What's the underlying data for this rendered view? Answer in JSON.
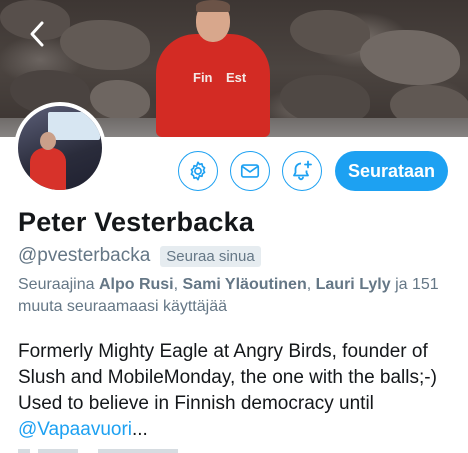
{
  "header": {
    "hoodie_text_left": "Fin",
    "hoodie_text_right": "Est"
  },
  "actions": {
    "settings_icon": "gear-icon",
    "message_icon": "envelope-icon",
    "notify_icon": "bell-plus-icon",
    "follow_label": "Seurataan"
  },
  "profile": {
    "name": "Peter Vesterbacka",
    "handle": "@pvesterbacka",
    "follows_you": "Seuraa sinua"
  },
  "followed_by": {
    "prefix": "Seuraajina",
    "user1": "Alpo Rusi",
    "sep1": ",",
    "user2": "Sami Yläoutinen",
    "sep2": ",",
    "user3": "Lauri Lyly",
    "suffix": "ja 151 muuta seuraamaasi käyttäjää"
  },
  "bio": {
    "text": "Formerly Mighty Eagle at Angry Birds, founder of Slush and MobileMonday, the one with the balls;-) Used to believe in Finnish democracy until ",
    "mention": "@Vapaavuori",
    "ellipsis": "..."
  },
  "colors": {
    "accent": "#1da1f2",
    "secondary_text": "#657786",
    "hoodie": "#d32b24"
  }
}
